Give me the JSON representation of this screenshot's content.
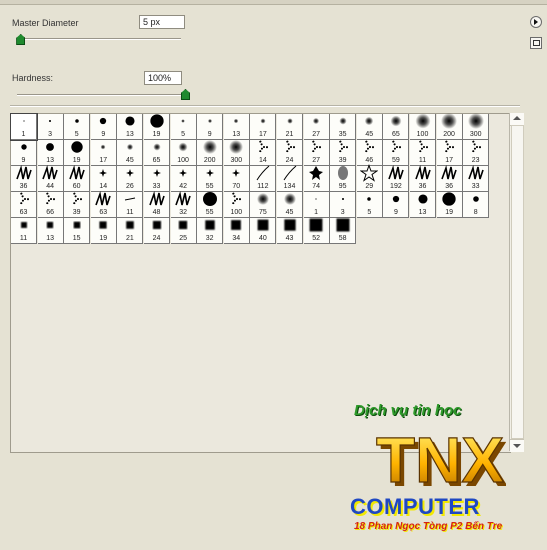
{
  "panel": {
    "master_diameter_label": "Master Diameter",
    "master_diameter_value": "5 px",
    "master_diameter_level": 0.02,
    "hardness_label": "Hardness:",
    "hardness_value": "100%",
    "hardness_level": 1.0
  },
  "brush_grid": {
    "rows": [
      [
        "1",
        "3",
        "5",
        "9",
        "13",
        "19",
        "5",
        "9",
        "13",
        "17",
        "21",
        "27",
        "35",
        "45",
        "65",
        "100",
        "200",
        "300"
      ],
      [
        "9",
        "13",
        "19",
        "17",
        "45",
        "65",
        "100",
        "200",
        "300",
        "14",
        "24",
        "27",
        "39",
        "46",
        "59",
        "11",
        "17",
        "23"
      ],
      [
        "36",
        "44",
        "60",
        "14",
        "26",
        "33",
        "42",
        "55",
        "70",
        "112",
        "134",
        "74",
        "95",
        "29",
        "192",
        "36",
        "36",
        "33"
      ],
      [
        "63",
        "66",
        "39",
        "63",
        "11",
        "48",
        "32",
        "55",
        "100",
        "75",
        "45",
        "1",
        "3",
        "5",
        "9",
        "13",
        "19",
        "8"
      ],
      [
        "11",
        "13",
        "15",
        "19",
        "21",
        "24",
        "25",
        "32",
        "34",
        "40",
        "43",
        "52",
        "58"
      ]
    ]
  },
  "watermark": {
    "line1": "Dịch vụ tin học",
    "logo_text": "TNX",
    "line2": "COMPUTER",
    "line3": "18 Phan Ngọc Tòng P2 Bến Tre"
  }
}
